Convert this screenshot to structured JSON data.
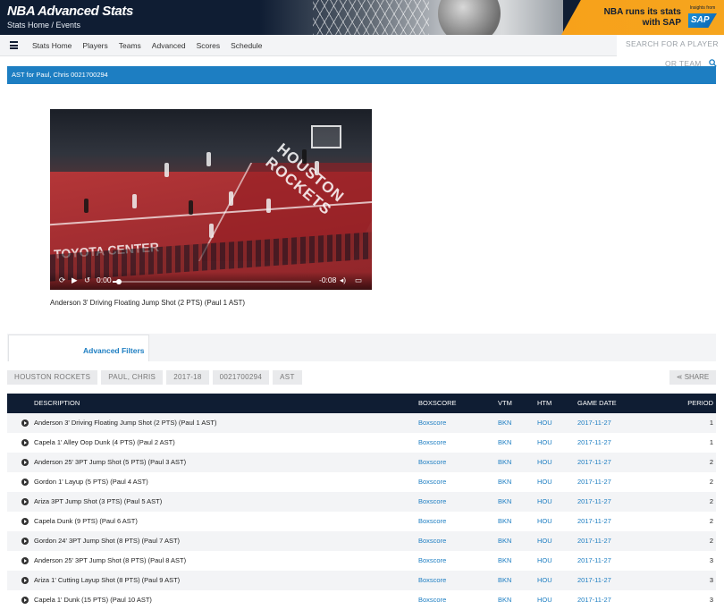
{
  "header": {
    "brand": "NBA Advanced Stats",
    "breadcrumb": "Stats Home / Events",
    "ad": {
      "headline_line1": "NBA runs its stats",
      "headline_line2": "with SAP",
      "tagline": "Insights from",
      "logo": "SAP"
    }
  },
  "nav": {
    "items": [
      "Stats Home",
      "Players",
      "Teams",
      "Advanced",
      "Scores",
      "Schedule"
    ],
    "search_placeholder": "SEARCH FOR A PLAYER",
    "search_overflow": "OR TEAM"
  },
  "title_bar": "AST for Paul, Chris 0021700294",
  "video": {
    "court_text": "HOUSTON ROCKETS",
    "sponsor_text": "TOYOTA CENTER",
    "current_time": "0:00",
    "remaining_time": "-0:08",
    "progress": 0.03,
    "caption": "Anderson 3' Driving Floating Jump Shot (2 PTS) (Paul 1 AST)"
  },
  "filters": {
    "tab_label": "Advanced Filters",
    "chips": [
      "HOUSTON ROCKETS",
      "PAUL, CHRIS",
      "2017-18",
      "0021700294",
      "AST"
    ],
    "share_label": "SHARE"
  },
  "table": {
    "headers": {
      "description": "DESCRIPTION",
      "boxscore": "BOXSCORE",
      "vtm": "VTM",
      "htm": "HTM",
      "game_date": "GAME DATE",
      "period": "PERIOD"
    },
    "rows": [
      {
        "description": "Anderson 3' Driving Floating Jump Shot (2 PTS) (Paul 1 AST)",
        "boxscore": "Boxscore",
        "vtm": "BKN",
        "htm": "HOU",
        "date": "2017-11-27",
        "period": "1"
      },
      {
        "description": "Capela 1' Alley Oop Dunk (4 PTS) (Paul 2 AST)",
        "boxscore": "Boxscore",
        "vtm": "BKN",
        "htm": "HOU",
        "date": "2017-11-27",
        "period": "1"
      },
      {
        "description": "Anderson 25' 3PT Jump Shot (5 PTS) (Paul 3 AST)",
        "boxscore": "Boxscore",
        "vtm": "BKN",
        "htm": "HOU",
        "date": "2017-11-27",
        "period": "2"
      },
      {
        "description": "Gordon 1' Layup (5 PTS) (Paul 4 AST)",
        "boxscore": "Boxscore",
        "vtm": "BKN",
        "htm": "HOU",
        "date": "2017-11-27",
        "period": "2"
      },
      {
        "description": "Ariza 3PT Jump Shot (3 PTS) (Paul 5 AST)",
        "boxscore": "Boxscore",
        "vtm": "BKN",
        "htm": "HOU",
        "date": "2017-11-27",
        "period": "2"
      },
      {
        "description": "Capela Dunk (9 PTS) (Paul 6 AST)",
        "boxscore": "Boxscore",
        "vtm": "BKN",
        "htm": "HOU",
        "date": "2017-11-27",
        "period": "2"
      },
      {
        "description": "Gordon 24' 3PT Jump Shot (8 PTS) (Paul 7 AST)",
        "boxscore": "Boxscore",
        "vtm": "BKN",
        "htm": "HOU",
        "date": "2017-11-27",
        "period": "2"
      },
      {
        "description": "Anderson 25' 3PT Jump Shot (8 PTS) (Paul 8 AST)",
        "boxscore": "Boxscore",
        "vtm": "BKN",
        "htm": "HOU",
        "date": "2017-11-27",
        "period": "3"
      },
      {
        "description": "Ariza 1' Cutting Layup Shot (8 PTS) (Paul 9 AST)",
        "boxscore": "Boxscore",
        "vtm": "BKN",
        "htm": "HOU",
        "date": "2017-11-27",
        "period": "3"
      },
      {
        "description": "Capela 1' Dunk (15 PTS) (Paul 10 AST)",
        "boxscore": "Boxscore",
        "vtm": "BKN",
        "htm": "HOU",
        "date": "2017-11-27",
        "period": "3"
      }
    ]
  }
}
